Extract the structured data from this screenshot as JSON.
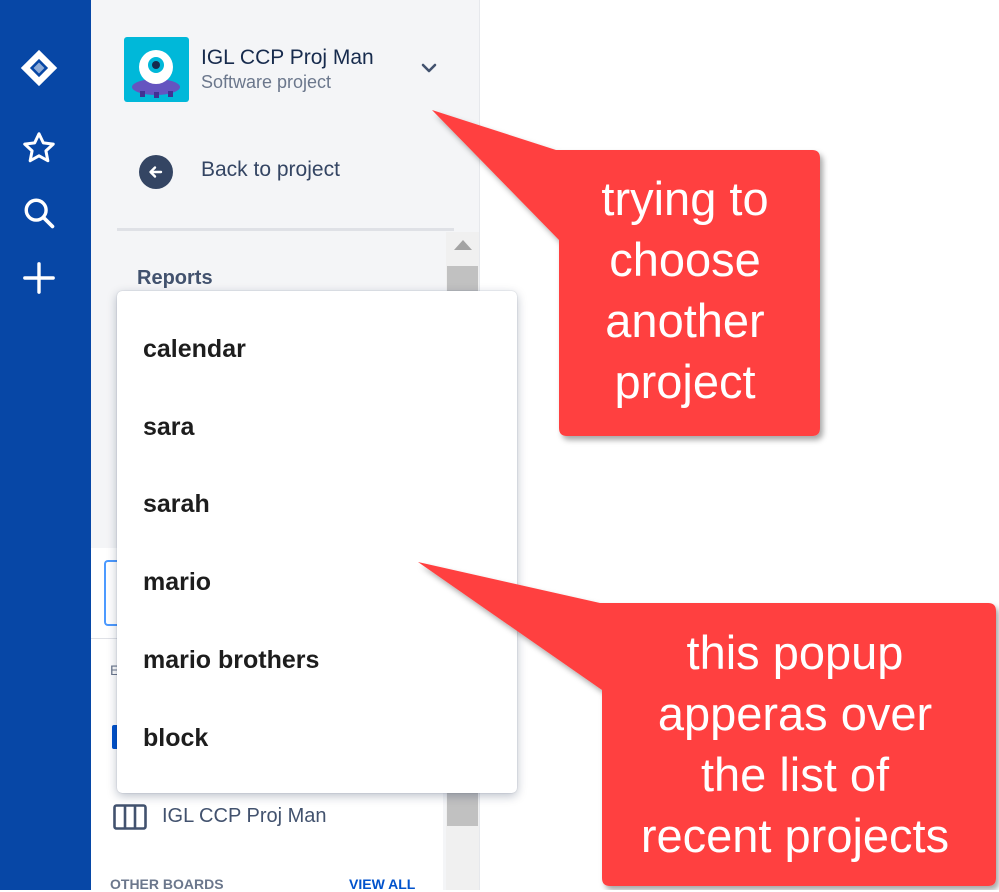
{
  "rail": {
    "icons": [
      "jira-logo-icon",
      "star-icon",
      "search-icon",
      "plus-icon"
    ]
  },
  "project": {
    "name": "IGL CCP Proj Man",
    "type": "Software project"
  },
  "nav": {
    "back_label": "Back to project",
    "reports_label": "Reports"
  },
  "popup": {
    "items": [
      "calendar",
      "sara",
      "sarah",
      "mario",
      "mario brothers",
      "block"
    ]
  },
  "boards": {
    "truncated_heading": "E",
    "current_board": "IGL CCP Proj Man",
    "other_heading": "OTHER BOARDS",
    "view_all": "VIEW ALL"
  },
  "annotations": {
    "callout_1": "trying to\nchoose\nanother\nproject",
    "callout_2": "this popup\napperas over\nthe list of\nrecent projects"
  },
  "colors": {
    "rail": "#0747A6",
    "sidebar": "#F4F5F7",
    "callout": "#FF4040",
    "avatar": "#00B8D9",
    "link": "#0052CC"
  }
}
